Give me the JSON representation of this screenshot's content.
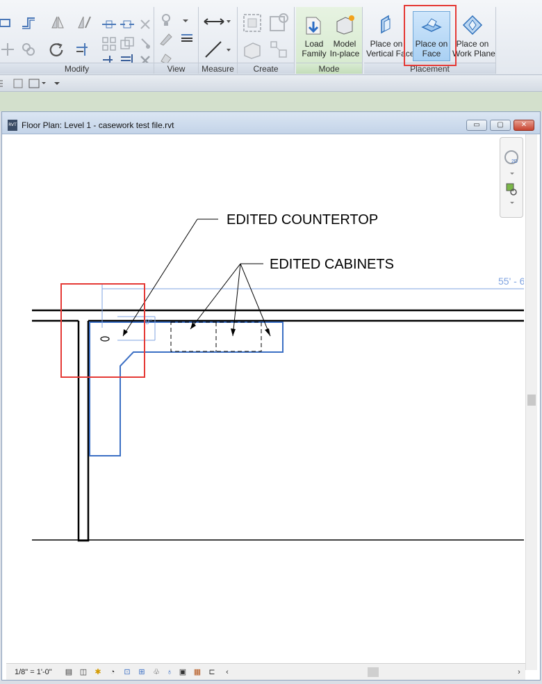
{
  "ribbon": {
    "panels": {
      "modify": "Modify",
      "view": "View",
      "measure": "Measure",
      "create": "Create",
      "mode": "Mode",
      "placement": "Placement"
    },
    "buttons": {
      "load_family": [
        "Load",
        "Family"
      ],
      "model_inplace": [
        "Model",
        "In-place"
      ],
      "place_vertical_face": [
        "Place on",
        "Vertical Face"
      ],
      "place_face": [
        "Place on",
        "Face"
      ],
      "place_work_plane": [
        "Place on",
        "Work Plane"
      ]
    },
    "selected_button": "Place on Face"
  },
  "view_window": {
    "title": "Floor Plan: Level 1 - casework test file.rvt",
    "min_label": "▭",
    "max_label": "▢",
    "close_label": "✕"
  },
  "drawing": {
    "annotation_countertop": "EDITED COUNTERTOP",
    "annotation_cabinets": "EDITED CABINETS",
    "dimension_label": "55' - 6",
    "small_dim": "9\""
  },
  "status_bar": {
    "scale": "1/8\" = 1'-0\""
  },
  "colors": {
    "highlight": "#e53935",
    "element_blue": "#3b6fc4",
    "dimension_blue": "#7fa3e0"
  }
}
